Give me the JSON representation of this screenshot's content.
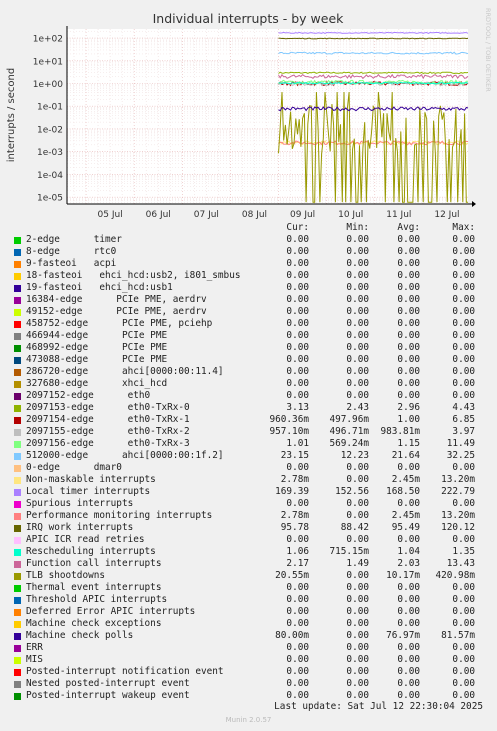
{
  "chart_data": {
    "type": "line",
    "title": "Individual interrupts - by week",
    "ylabel": "interrupts / second",
    "yscale": "log",
    "ylim": [
      5e-06,
      250
    ],
    "y_ticks": [
      "1e-05",
      "1e-04",
      "1e-03",
      "1e-02",
      "1e-01",
      "1e+00",
      "1e+01",
      "1e+02"
    ],
    "x_ticks": [
      "05 Jul",
      "06 Jul",
      "07 Jul",
      "08 Jul",
      "09 Jul",
      "10 Jul",
      "11 Jul",
      "12 Jul"
    ],
    "x_range": [
      "04 Jul 2025 14:30",
      "12 Jul 2025 22:30"
    ],
    "data_start": "09 Jul 2025 00:00",
    "grid": true,
    "watermark": "RRDTOOL / TOBI OETIKER",
    "legend_headers": {
      "cur": "Cur:",
      "min": "Min:",
      "avg": "Avg:",
      "max": "Max:"
    },
    "series": [
      {
        "name": "2-edge      timer",
        "color": "#00cc00",
        "cur": "0.00",
        "min": "0.00",
        "avg": "0.00",
        "max": "0.00"
      },
      {
        "name": "8-edge      rtc0",
        "color": "#0066b3",
        "cur": "0.00",
        "min": "0.00",
        "avg": "0.00",
        "max": "0.00"
      },
      {
        "name": "9-fasteoi   acpi",
        "color": "#ff8000",
        "cur": "0.00",
        "min": "0.00",
        "avg": "0.00",
        "max": "0.00"
      },
      {
        "name": "18-fasteoi   ehci_hcd:usb2, i801_smbus",
        "color": "#ffcc00",
        "cur": "0.00",
        "min": "0.00",
        "avg": "0.00",
        "max": "0.00"
      },
      {
        "name": "19-fasteoi   ehci_hcd:usb1",
        "color": "#330099",
        "cur": "0.00",
        "min": "0.00",
        "avg": "0.00",
        "max": "0.00"
      },
      {
        "name": "16384-edge      PCIe PME, aerdrv",
        "color": "#990099",
        "cur": "0.00",
        "min": "0.00",
        "avg": "0.00",
        "max": "0.00"
      },
      {
        "name": "49152-edge      PCIe PME, aerdrv",
        "color": "#ccff00",
        "cur": "0.00",
        "min": "0.00",
        "avg": "0.00",
        "max": "0.00"
      },
      {
        "name": "458752-edge      PCIe PME, pciehp",
        "color": "#ff0000",
        "cur": "0.00",
        "min": "0.00",
        "avg": "0.00",
        "max": "0.00"
      },
      {
        "name": "466944-edge      PCIe PME",
        "color": "#808080",
        "cur": "0.00",
        "min": "0.00",
        "avg": "0.00",
        "max": "0.00"
      },
      {
        "name": "468992-edge      PCIe PME",
        "color": "#008f00",
        "cur": "0.00",
        "min": "0.00",
        "avg": "0.00",
        "max": "0.00"
      },
      {
        "name": "473088-edge      PCIe PME",
        "color": "#00487d",
        "cur": "0.00",
        "min": "0.00",
        "avg": "0.00",
        "max": "0.00"
      },
      {
        "name": "286720-edge      ahci[0000:00:11.4]",
        "color": "#b35a00",
        "cur": "0.00",
        "min": "0.00",
        "avg": "0.00",
        "max": "0.00"
      },
      {
        "name": "327680-edge      xhci_hcd",
        "color": "#b38f00",
        "cur": "0.00",
        "min": "0.00",
        "avg": "0.00",
        "max": "0.00"
      },
      {
        "name": "2097152-edge      eth0",
        "color": "#6b006b",
        "cur": "0.00",
        "min": "0.00",
        "avg": "0.00",
        "max": "0.00"
      },
      {
        "name": "2097153-edge      eth0-TxRx-0",
        "color": "#8fb300",
        "cur": "3.13",
        "min": "2.43",
        "avg": "2.96",
        "max": "4.43"
      },
      {
        "name": "2097154-edge      eth0-TxRx-1",
        "color": "#b30000",
        "cur": "960.36m",
        "min": "497.96m",
        "avg": "1.00",
        "max": "6.85"
      },
      {
        "name": "2097155-edge      eth0-TxRx-2",
        "color": "#bebebe",
        "cur": "957.10m",
        "min": "496.71m",
        "avg": "983.81m",
        "max": "3.97"
      },
      {
        "name": "2097156-edge      eth0-TxRx-3",
        "color": "#80ff80",
        "cur": "1.01",
        "min": "569.24m",
        "avg": "1.15",
        "max": "11.49"
      },
      {
        "name": "512000-edge      ahci[0000:00:1f.2]",
        "color": "#80c9ff",
        "cur": "23.15",
        "min": "12.23",
        "avg": "21.64",
        "max": "32.25"
      },
      {
        "name": "0-edge      dmar0",
        "color": "#ffc080",
        "cur": "0.00",
        "min": "0.00",
        "avg": "0.00",
        "max": "0.00"
      },
      {
        "name": "Non-maskable interrupts",
        "color": "#ffe680",
        "cur": "2.78m",
        "min": "0.00",
        "avg": "2.45m",
        "max": "13.20m"
      },
      {
        "name": "Local timer interrupts",
        "color": "#aa80ff",
        "cur": "169.39",
        "min": "152.56",
        "avg": "168.50",
        "max": "222.79"
      },
      {
        "name": "Spurious interrupts",
        "color": "#ee00cc",
        "cur": "0.00",
        "min": "0.00",
        "avg": "0.00",
        "max": "0.00"
      },
      {
        "name": "Performance monitoring interrupts",
        "color": "#ff8080",
        "cur": "2.78m",
        "min": "0.00",
        "avg": "2.45m",
        "max": "13.20m"
      },
      {
        "name": "IRQ work interrupts",
        "color": "#666600",
        "cur": "95.78",
        "min": "88.42",
        "avg": "95.49",
        "max": "120.12"
      },
      {
        "name": "APIC ICR read retries",
        "color": "#ffbfff",
        "cur": "0.00",
        "min": "0.00",
        "avg": "0.00",
        "max": "0.00"
      },
      {
        "name": "Rescheduling interrupts",
        "color": "#00ffcc",
        "cur": "1.06",
        "min": "715.15m",
        "avg": "1.04",
        "max": "1.35"
      },
      {
        "name": "Function call interrupts",
        "color": "#cc6699",
        "cur": "2.17",
        "min": "1.49",
        "avg": "2.03",
        "max": "13.43"
      },
      {
        "name": "TLB shootdowns",
        "color": "#999900",
        "cur": "20.55m",
        "min": "0.00",
        "avg": "10.17m",
        "max": "420.98m"
      },
      {
        "name": "Thermal event interrupts",
        "color": "#00cc00",
        "cur": "0.00",
        "min": "0.00",
        "avg": "0.00",
        "max": "0.00"
      },
      {
        "name": "Threshold APIC interrupts",
        "color": "#0066b3",
        "cur": "0.00",
        "min": "0.00",
        "avg": "0.00",
        "max": "0.00"
      },
      {
        "name": "Deferred Error APIC interrupts",
        "color": "#ff8000",
        "cur": "0.00",
        "min": "0.00",
        "avg": "0.00",
        "max": "0.00"
      },
      {
        "name": "Machine check exceptions",
        "color": "#ffcc00",
        "cur": "0.00",
        "min": "0.00",
        "avg": "0.00",
        "max": "0.00"
      },
      {
        "name": "Machine check polls",
        "color": "#330099",
        "cur": "80.00m",
        "min": "0.00",
        "avg": "76.97m",
        "max": "81.57m"
      },
      {
        "name": "ERR",
        "color": "#990099",
        "cur": "0.00",
        "min": "0.00",
        "avg": "0.00",
        "max": "0.00"
      },
      {
        "name": "MIS",
        "color": "#ccff00",
        "cur": "0.00",
        "min": "0.00",
        "avg": "0.00",
        "max": "0.00"
      },
      {
        "name": "Posted-interrupt notification event",
        "color": "#ff0000",
        "cur": "0.00",
        "min": "0.00",
        "avg": "0.00",
        "max": "0.00"
      },
      {
        "name": "Nested posted-interrupt event",
        "color": "#808080",
        "cur": "0.00",
        "min": "0.00",
        "avg": "0.00",
        "max": "0.00"
      },
      {
        "name": "Posted-interrupt wakeup event",
        "color": "#008f00",
        "cur": "0.00",
        "min": "0.00",
        "avg": "0.00",
        "max": "0.00"
      }
    ]
  },
  "footer": {
    "last_update": "Last update: Sat Jul 12 22:30:04 2025",
    "credit": "Munin 2.0.57"
  }
}
